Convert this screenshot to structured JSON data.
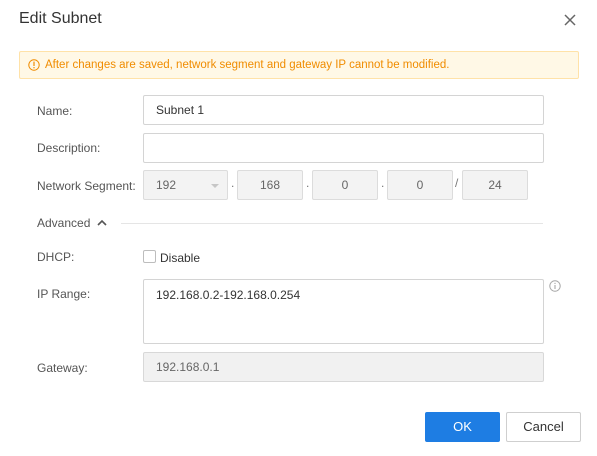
{
  "dialog": {
    "title": "Edit Subnet",
    "close_icon": "close-icon",
    "warning": "After changes are saved, network segment and gateway IP cannot be modified.",
    "warning_icon": "info-circle-icon",
    "accent_color": "#1e7de3",
    "warning_color": "#f08c00"
  },
  "form": {
    "name_label": "Name:",
    "name_value": "Subnet 1",
    "description_label": "Description:",
    "description_value": "",
    "segment_label": "Network Segment:",
    "segment": {
      "octet1": "192",
      "octet2": "168",
      "octet3": "0",
      "octet4": "0",
      "dot1": ".",
      "dot2": ".",
      "dot3": ".",
      "slash": "/",
      "mask": "24"
    },
    "advanced_label": "Advanced",
    "dhcp_label": "DHCP:",
    "dhcp_checkbox_label": "Disable",
    "dhcp_checked": false,
    "ip_range_label": "IP Range:",
    "ip_range_value": "192.168.0.2-192.168.0.254",
    "gateway_label": "Gateway:",
    "gateway_value": "192.168.0.1"
  },
  "buttons": {
    "ok": "OK",
    "cancel": "Cancel"
  }
}
